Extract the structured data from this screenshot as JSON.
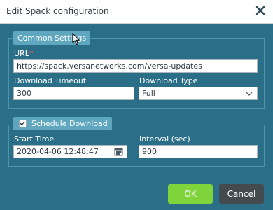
{
  "dialog": {
    "title": "Edit Spack configuration",
    "icons": {
      "close": "close-icon",
      "calendar": "calendar-icon",
      "dropdown": "chevron-down-icon",
      "check": "checkmark-icon"
    }
  },
  "common": {
    "legend": "Common Settings",
    "url_label": "URL",
    "url_required": "*",
    "url_value": "https://spack.versanetworks.com/versa-updates",
    "timeout_label": "Download Timeout",
    "timeout_value": "300",
    "type_label": "Download Type",
    "type_value": "Full"
  },
  "schedule": {
    "legend": "Schedule Download",
    "checked": true,
    "start_label": "Start Time",
    "start_value": "2020-04-06 12:48:47",
    "interval_label": "Interval (sec)",
    "interval_value": "900"
  },
  "footer": {
    "ok_label": "OK",
    "cancel_label": "Cancel"
  },
  "colors": {
    "dialog_bg": "#2a6f87",
    "ok": "#7fd43c",
    "cancel": "#444b4f"
  }
}
